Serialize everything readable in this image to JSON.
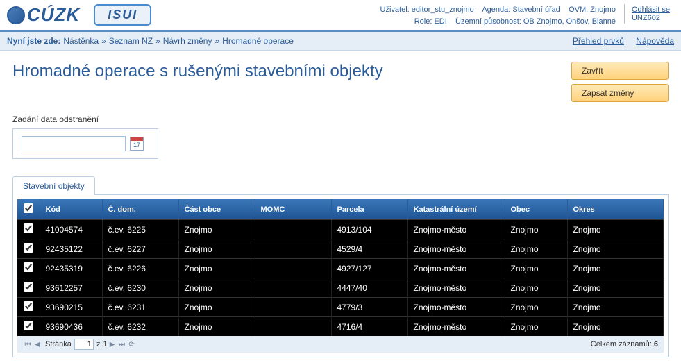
{
  "header": {
    "logo_cuzk": "CÚZK",
    "logo_isui": "ISUI",
    "user_label": "Uživatel:",
    "user_value": "editor_stu_znojmo",
    "agenda_label": "Agenda:",
    "agenda_value": "Stavební úřad",
    "ovm_label": "OVM:",
    "ovm_value": "Znojmo",
    "role_label": "Role:",
    "role_value": "EDI",
    "scope_label": "Územní působnost:",
    "scope_value": "OB Znojmo, Onšov, Blanné",
    "logout_label": "Odhlásit se",
    "logout_code": "UNZ602"
  },
  "breadcrumb": {
    "prefix": "Nyní jste zde:",
    "items": [
      "Nástěnka",
      "Seznam NZ",
      "Návrh změny",
      "Hromadné operace"
    ],
    "link_overview": "Přehled prvků",
    "link_help": "Nápověda"
  },
  "page": {
    "title": "Hromadné operace s rušenými stavebními objekty",
    "btn_close": "Zavřít",
    "btn_save": "Zapsat změny",
    "date_section_label": "Zadání data odstranění",
    "date_value": ""
  },
  "tabs": {
    "active_label": "Stavební objekty"
  },
  "table": {
    "headers": [
      "",
      "Kód",
      "Č. dom.",
      "Část obce",
      "MOMC",
      "Parcela",
      "Katastrální území",
      "Obec",
      "Okres"
    ],
    "rows": [
      {
        "checked": true,
        "kod": "41004574",
        "cdom": "č.ev. 6225",
        "cast": "Znojmo",
        "momc": "",
        "parcela": "4913/104",
        "ku": "Znojmo-město",
        "obec": "Znojmo",
        "okres": "Znojmo"
      },
      {
        "checked": true,
        "kod": "92435122",
        "cdom": "č.ev. 6227",
        "cast": "Znojmo",
        "momc": "",
        "parcela": "4529/4",
        "ku": "Znojmo-město",
        "obec": "Znojmo",
        "okres": "Znojmo"
      },
      {
        "checked": true,
        "kod": "92435319",
        "cdom": "č.ev. 6226",
        "cast": "Znojmo",
        "momc": "",
        "parcela": "4927/127",
        "ku": "Znojmo-město",
        "obec": "Znojmo",
        "okres": "Znojmo"
      },
      {
        "checked": true,
        "kod": "93612257",
        "cdom": "č.ev. 6230",
        "cast": "Znojmo",
        "momc": "",
        "parcela": "4447/40",
        "ku": "Znojmo-město",
        "obec": "Znojmo",
        "okres": "Znojmo"
      },
      {
        "checked": true,
        "kod": "93690215",
        "cdom": "č.ev. 6231",
        "cast": "Znojmo",
        "momc": "",
        "parcela": "4779/3",
        "ku": "Znojmo-město",
        "obec": "Znojmo",
        "okres": "Znojmo"
      },
      {
        "checked": true,
        "kod": "93690436",
        "cdom": "č.ev. 6232",
        "cast": "Znojmo",
        "momc": "",
        "parcela": "4716/4",
        "ku": "Znojmo-město",
        "obec": "Znojmo",
        "okres": "Znojmo"
      }
    ]
  },
  "pager": {
    "page_label": "Stránka",
    "page_value": "1",
    "of_label": "z",
    "total_pages": "1",
    "total_label": "Celkem záznamů:",
    "total_count": "6"
  }
}
